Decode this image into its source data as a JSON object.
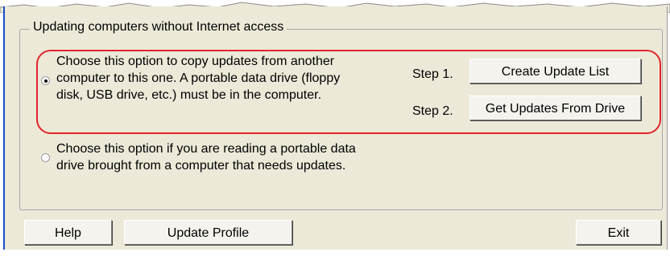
{
  "group": {
    "title": "Updating computers without Internet access"
  },
  "option1": {
    "selected": true,
    "lines": [
      "Choose this option to copy updates from another",
      "computer to this one. A portable data drive (floppy",
      "disk, USB drive, etc.) must be in the computer."
    ]
  },
  "steps": [
    {
      "label": "Step 1.",
      "button": "Create Update List"
    },
    {
      "label": "Step 2.",
      "button": "Get Updates From Drive"
    }
  ],
  "option2": {
    "selected": false,
    "lines": [
      "Choose this option if you are reading a portable data",
      "drive brought from a computer that needs updates."
    ]
  },
  "footer": {
    "help": "Help",
    "update_profile": "Update Profile",
    "exit": "Exit"
  },
  "colors": {
    "dialog_bg": "#ece9d8",
    "highlight": "#e0252a",
    "window_edge": "#1a4fc8"
  }
}
